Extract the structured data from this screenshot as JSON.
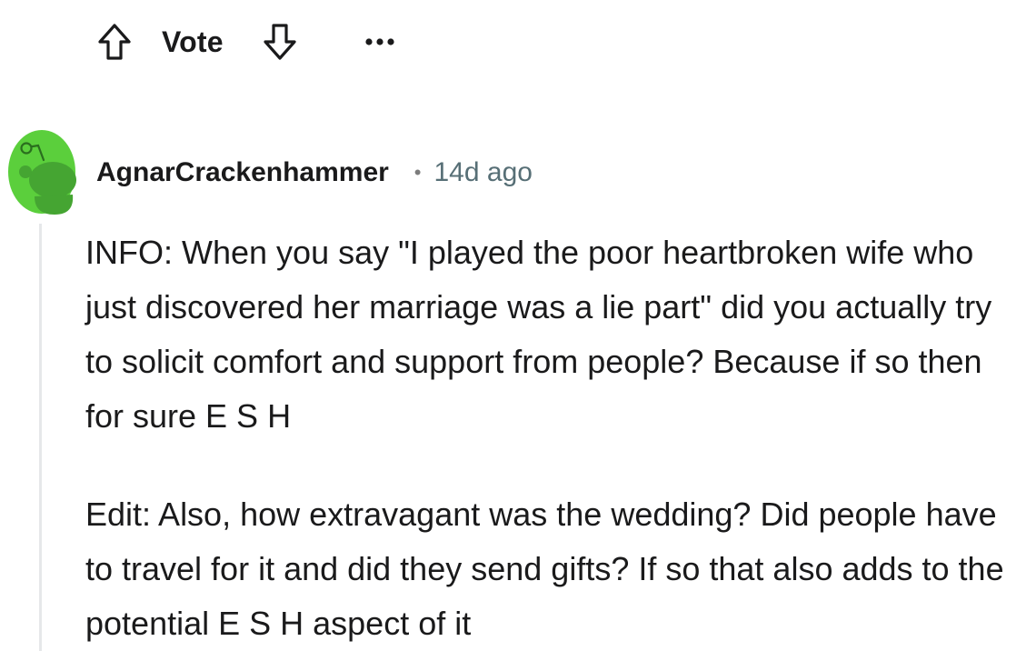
{
  "vote": {
    "label": "Vote",
    "upvote_icon": "arrow-up-outline-icon",
    "downvote_icon": "arrow-down-outline-icon",
    "more_icon": "ellipsis-icon"
  },
  "comment": {
    "author": "AgnarCrackenhammer",
    "separator": "•",
    "time": "14d ago",
    "avatar_icon": "snoo-avatar-icon",
    "avatar_color": "#5bcf3c",
    "paragraphs": [
      "INFO: When you say \"I played the poor heartbroken wife who just discovered her marriage was a lie part\" did you actually try to solicit comfort and support from people? Because if so then for sure E S H",
      "Edit: Also, how extravagant was the wedding? Did people have to travel for it and did they send gifts? If so that also adds to the potential E S H aspect of it"
    ]
  },
  "colors": {
    "text": "#1a1a1b",
    "meta": "#576f76",
    "thread_line": "#e6e8ea"
  }
}
